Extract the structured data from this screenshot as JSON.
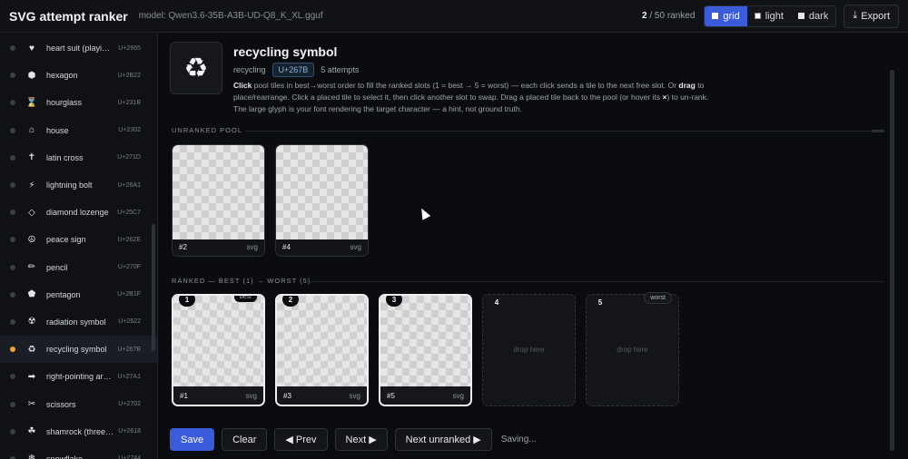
{
  "app": {
    "title": "SVG attempt ranker",
    "model": "model: Qwen3.6-35B-A3B-UD-Q8_K_XL.gguf",
    "ranked_done": "2",
    "ranked_total": " / 50 ranked",
    "themes": [
      {
        "label": "grid",
        "active": true
      },
      {
        "label": "light",
        "active": false
      },
      {
        "label": "dark",
        "active": false
      }
    ],
    "export_label": "Export"
  },
  "sidebar": {
    "items": [
      {
        "glyph": "♥",
        "label": "heart suit (playi…",
        "code": "U+2665",
        "state": "none"
      },
      {
        "glyph": "⬢",
        "label": "hexagon",
        "code": "U+2B22",
        "state": "none"
      },
      {
        "glyph": "⌛",
        "label": "hourglass",
        "code": "U+231B",
        "state": "none"
      },
      {
        "glyph": "⌂",
        "label": "house",
        "code": "U+2302",
        "state": "none"
      },
      {
        "glyph": "✝",
        "label": "latin cross",
        "code": "U+271D",
        "state": "none"
      },
      {
        "glyph": "⚡",
        "label": "lightning bolt",
        "code": "U+26A1",
        "state": "none"
      },
      {
        "glyph": "◇",
        "label": "diamond lozenge",
        "code": "U+25C7",
        "state": "none"
      },
      {
        "glyph": "☮",
        "label": "peace sign",
        "code": "U+262E",
        "state": "none"
      },
      {
        "glyph": "✏",
        "label": "pencil",
        "code": "U+270F",
        "state": "none"
      },
      {
        "glyph": "⬟",
        "label": "pentagon",
        "code": "U+2B1F",
        "state": "none"
      },
      {
        "glyph": "☢",
        "label": "radiation symbol",
        "code": "U+2622",
        "state": "none"
      },
      {
        "glyph": "♻",
        "label": "recycling symbol",
        "code": "U+267B",
        "state": "active"
      },
      {
        "glyph": "➡",
        "label": "right-pointing arr…",
        "code": "U+27A1",
        "state": "none"
      },
      {
        "glyph": "✂",
        "label": "scissors",
        "code": "U+2702",
        "state": "none"
      },
      {
        "glyph": "☘",
        "label": "shamrock (three…",
        "code": "U+2618",
        "state": "none"
      },
      {
        "glyph": "❄",
        "label": "snowflake",
        "code": "U+2744",
        "state": "none"
      }
    ]
  },
  "main": {
    "glyph": "♻",
    "title": "recycling symbol",
    "name": "recycling",
    "code": "U+267B",
    "attempts": "5 attempts",
    "instructions": {
      "click_bold": "Click",
      "part1": " pool tiles in best→worst order to fill the ranked slots (1 = best → 5 = worst) — each click sends a tile to the next free slot. Or ",
      "drag_bold": "drag",
      "part2": " to place/rearrange. Click a placed tile to select it, then click another slot to swap. Drag a placed tile back to the pool (or hover its ",
      "x_bold": "×",
      "part3": ") to un-rank. The large glyph is your font rendering the target character — a hint, not ground truth."
    },
    "pool_label": "UNRANKED POOL",
    "pool": [
      {
        "id": "#2",
        "kind": "svg"
      },
      {
        "id": "#4",
        "kind": "svg"
      }
    ],
    "ranked_label": "RANKED — BEST (1) → WORST (5)",
    "ranked": [
      {
        "rank": "1",
        "id": "#1",
        "kind": "svg",
        "tag": "best",
        "filled": true
      },
      {
        "rank": "2",
        "id": "#3",
        "kind": "svg",
        "tag": "",
        "filled": true
      },
      {
        "rank": "3",
        "id": "#5",
        "kind": "svg",
        "tag": "",
        "filled": true
      },
      {
        "rank": "4",
        "id": "",
        "kind": "",
        "tag": "",
        "filled": false
      },
      {
        "rank": "5",
        "id": "",
        "kind": "",
        "tag": "worst",
        "filled": false
      }
    ],
    "drop_label": "drop here"
  },
  "actions": {
    "save": "Save",
    "clear": "Clear",
    "prev": "◀ Prev",
    "next": "Next ▶",
    "next_unranked": "Next unranked ▶",
    "status": "Saving..."
  }
}
